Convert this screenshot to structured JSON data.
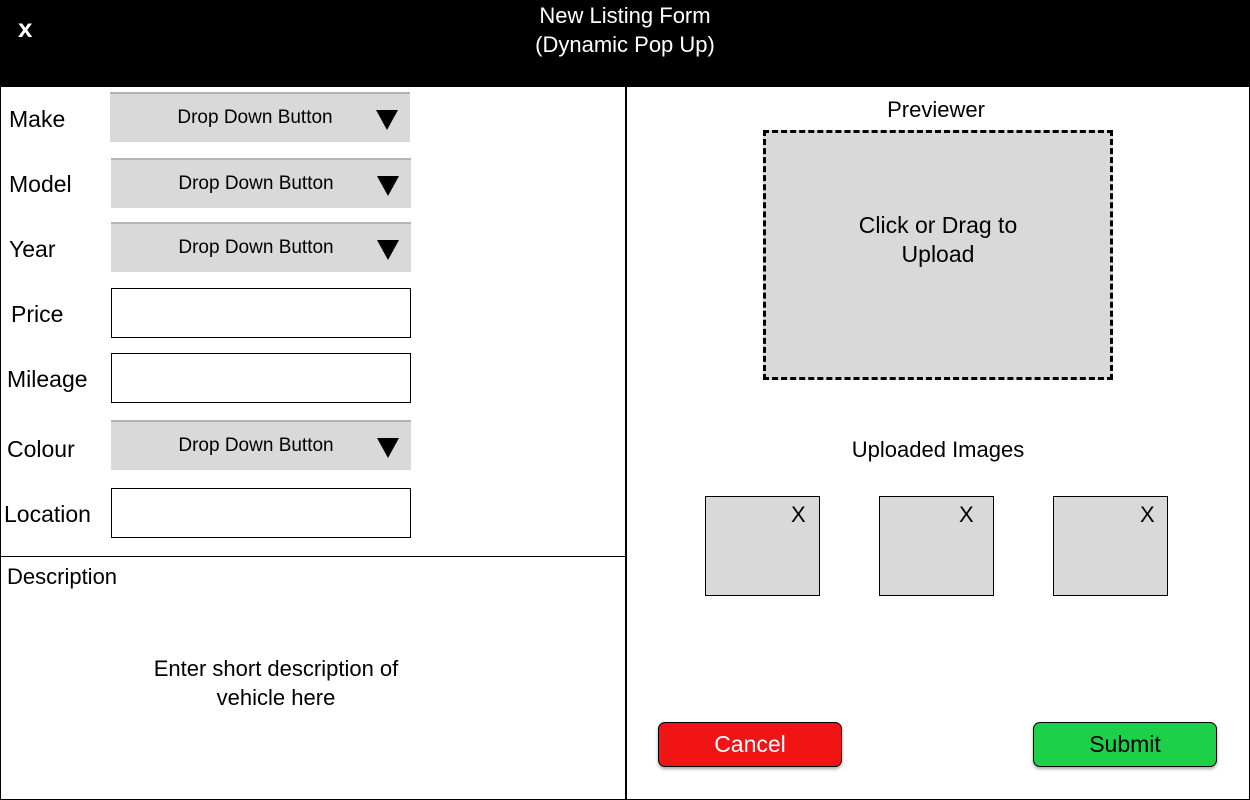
{
  "header": {
    "close_label": "x",
    "title_line1": "New Listing Form",
    "title_line2": "(Dynamic Pop Up)"
  },
  "form": {
    "make": {
      "label": "Make",
      "value": "Drop Down Button"
    },
    "model": {
      "label": "Model",
      "value": "Drop Down Button"
    },
    "year": {
      "label": "Year",
      "value": "Drop Down Button"
    },
    "price": {
      "label": "Price",
      "value": ""
    },
    "mileage": {
      "label": "Mileage",
      "value": ""
    },
    "colour": {
      "label": "Colour",
      "value": "Drop Down Button"
    },
    "location": {
      "label": "Location",
      "value": ""
    }
  },
  "description": {
    "label": "Description",
    "hint_line1": "Enter short description of",
    "hint_line2": "vehicle here"
  },
  "previewer": {
    "title": "Previewer",
    "upload_line1": "Click or Drag to",
    "upload_line2": "Upload"
  },
  "uploaded": {
    "title": "Uploaded Images",
    "remove_label": "X"
  },
  "actions": {
    "cancel_label": "Cancel",
    "submit_label": "Submit"
  },
  "colors": {
    "header_bg": "#000000",
    "field_gray": "#d9d9d9",
    "cancel": "#f01414",
    "submit": "#1dcf49"
  }
}
